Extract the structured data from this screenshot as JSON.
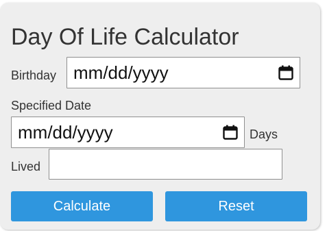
{
  "calculator": {
    "title": "Day Of Life Calculator",
    "birthday": {
      "label": "Birthday",
      "value": "mm/dd/yyyy",
      "icon": "calendar-icon"
    },
    "specified_date": {
      "label": "Specified Date",
      "value": "mm/dd/yyyy",
      "icon": "calendar-icon"
    },
    "days_lived": {
      "label_line1": "Days",
      "label_line2": "Lived",
      "value": ""
    },
    "buttons": {
      "calculate": "Calculate",
      "reset": "Reset"
    },
    "colors": {
      "button": "#2f96de",
      "card": "#eeeeee",
      "text": "#333333"
    }
  }
}
